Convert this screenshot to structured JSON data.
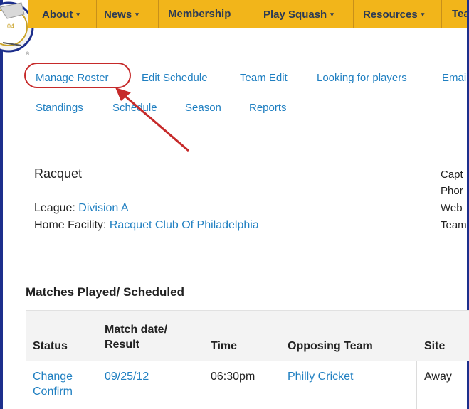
{
  "nav": {
    "items": [
      {
        "label": "About",
        "caret": "▾"
      },
      {
        "label": "News",
        "caret": "▾"
      },
      {
        "label": "Membership",
        "caret": ""
      },
      {
        "label": "Play Squash",
        "caret": "▾"
      },
      {
        "label": "Resources",
        "caret": "▾"
      },
      {
        "label": "Tea",
        "caret": ""
      }
    ]
  },
  "subnav": {
    "row1": [
      "Manage Roster",
      "Edit Schedule",
      "Team Edit",
      "Looking for players",
      "Emai"
    ],
    "row2": [
      "Standings",
      "Schedule",
      "Season",
      "Reports"
    ]
  },
  "team": {
    "name": "Racquet",
    "league_label": "League:",
    "league_value": "Division A",
    "facility_label": "Home Facility:",
    "facility_value": "Racquet Club Of Philadelphia"
  },
  "right_col": [
    "Capt",
    "Phor",
    "Web",
    "Team"
  ],
  "matches": {
    "title": "Matches Played/ Scheduled",
    "headers": [
      "Status",
      "Match date/",
      "Result",
      "Time",
      "Opposing Team",
      "Site"
    ],
    "row": {
      "status_line1": "Change",
      "status_line2": "Confirm",
      "date": "09/25/12",
      "time": "06:30pm",
      "opponent": "Philly Cricket",
      "site": "Away"
    }
  },
  "colors": {
    "nav_bg": "#f2b51a",
    "link": "#1f7fc1",
    "annotation_red": "#c62a2a",
    "frame_blue": "#1d2f8c"
  },
  "icons": [
    "club-logo-icon",
    "annotation-arrow-icon"
  ]
}
